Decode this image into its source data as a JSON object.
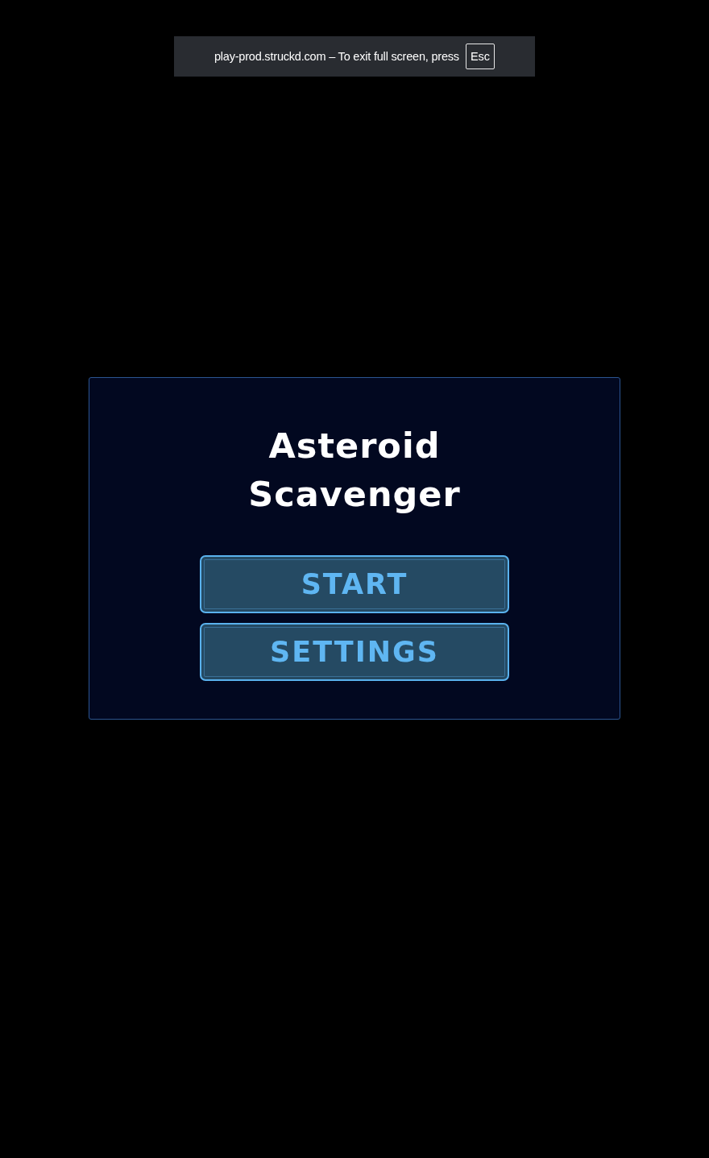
{
  "fullscreen_notice": {
    "text": "play-prod.struckd.com – To exit full screen, press",
    "key": "Esc"
  },
  "menu": {
    "title": "Asteroid Scavenger",
    "buttons": [
      {
        "label": "START"
      },
      {
        "label": "SETTINGS"
      }
    ]
  }
}
